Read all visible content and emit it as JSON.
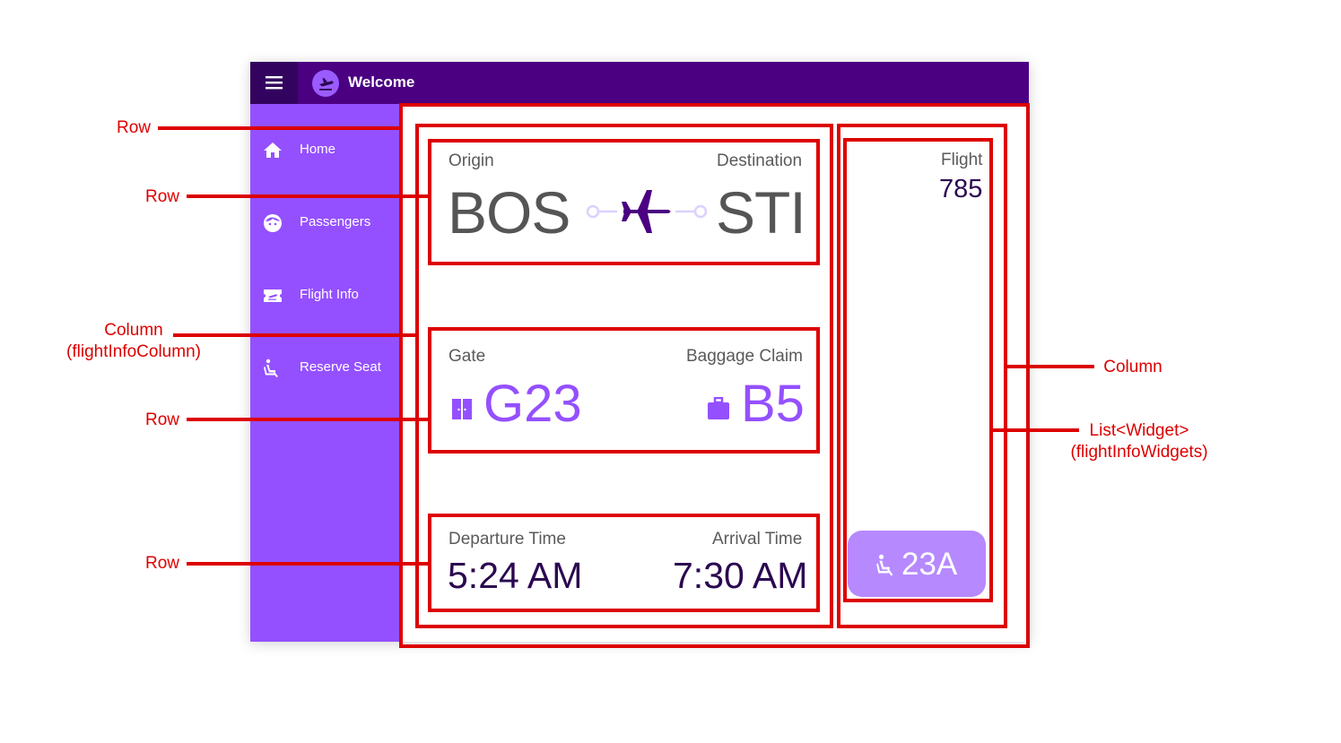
{
  "appbar": {
    "title": "Welcome"
  },
  "sidebar": {
    "items": [
      {
        "label": "Home",
        "icon": "home-icon"
      },
      {
        "label": "Passengers",
        "icon": "face-icon"
      },
      {
        "label": "Flight Info",
        "icon": "flight-ticket-icon"
      },
      {
        "label": "Reserve Seat",
        "icon": "seat-icon"
      }
    ]
  },
  "route": {
    "origin_label": "Origin",
    "origin": "BOS",
    "destination_label": "Destination",
    "destination": "STI"
  },
  "gate_info": {
    "gate_label": "Gate",
    "gate": "G23",
    "baggage_label": "Baggage Claim",
    "baggage": "B5"
  },
  "times": {
    "departure_label": "Departure Time",
    "departure": "5:24 AM",
    "arrival_label": "Arrival Time",
    "arrival": "7:30 AM"
  },
  "flight": {
    "label": "Flight",
    "number": "785",
    "seat": "23A"
  },
  "annotations": {
    "row_outer": "Row",
    "row_route": "Row",
    "column_flight_info": "Column",
    "column_flight_info_name": "(flightInfoColumn)",
    "row_gate": "Row",
    "row_times": "Row",
    "column_right": "Column",
    "list_widget": "List<Widget>",
    "list_widget_name": "(flightInfoWidgets)"
  },
  "colors": {
    "appbar": "#4b0082",
    "sidebar": "#9450ff",
    "accent": "#9450ff",
    "annotation": "#dd0000",
    "seat_chip": "#b689ff"
  }
}
